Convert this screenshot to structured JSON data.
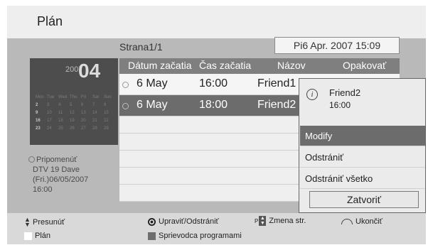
{
  "title": "Plán",
  "page_indicator": "Strana1/1",
  "datetime": "Pi6 Apr. 2007 15:09",
  "calendar": {
    "year": "2007",
    "month": "04",
    "weekdays": [
      "Mon",
      "Tue",
      "Wed",
      "Thu",
      "Fri",
      "Sat",
      "Sun"
    ],
    "weeks": [
      [
        "2",
        "3",
        "4",
        "5",
        "6",
        "7",
        "8"
      ],
      [
        "9",
        "10",
        "11",
        "12",
        "13",
        "14",
        "15"
      ],
      [
        "16",
        "17",
        "18",
        "19",
        "20",
        "21",
        "22"
      ],
      [
        "23",
        "24",
        "25",
        "26",
        "27",
        "28",
        "29"
      ]
    ]
  },
  "reminder": {
    "line1": "Pripomenúť",
    "line2": "DTV 19 Dave",
    "line3": "(Fri.)06/05/2007",
    "line4": "16:00"
  },
  "table": {
    "headers": [
      "Dátum začatia",
      "Čas začatia",
      "Názov",
      "Opakovať"
    ],
    "rows": [
      {
        "date": "6 May",
        "time": "16:00",
        "name": "Friend1",
        "selected": false
      },
      {
        "date": "6 May",
        "time": "18:00",
        "name": "Friend2",
        "selected": true
      }
    ]
  },
  "popup": {
    "program": "Friend2",
    "time": "16:00",
    "items": [
      "Modify",
      "Odstrániť",
      "Odstrániť všetko"
    ],
    "close_label": "Zatvoriť"
  },
  "legend": {
    "move": "Presunúť",
    "edit_delete": "Upraviť/Odstrániť",
    "p_label": "P",
    "change_page": "Zmena str.",
    "exit": "Ukončiť",
    "schedule": "Plán",
    "guide": "Sprievodca programami",
    "schedule_color": "#ffffff",
    "guide_color": "#6e6e6e"
  }
}
